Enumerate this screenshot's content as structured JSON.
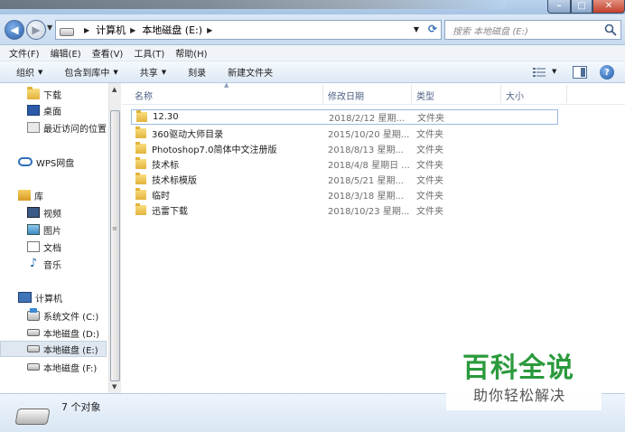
{
  "address": {
    "crumbs": [
      "计算机",
      "本地磁盘 (E:)"
    ]
  },
  "search": {
    "placeholder": "搜索 本地磁盘 (E:)"
  },
  "menu": [
    "文件(F)",
    "编辑(E)",
    "查看(V)",
    "工具(T)",
    "帮助(H)"
  ],
  "commands": {
    "organize": "组织",
    "include": "包含到库中",
    "share": "共享",
    "burn": "刻录",
    "new_folder": "新建文件夹"
  },
  "nav": {
    "downloads": "下载",
    "desktop": "桌面",
    "recent": "最近访问的位置",
    "wps": "WPS网盘",
    "libraries": "库",
    "videos": "视频",
    "pictures": "图片",
    "documents": "文档",
    "music": "音乐",
    "computer": "计算机",
    "drive_c": "系统文件 (C:)",
    "drive_d": "本地磁盘 (D:)",
    "drive_e": "本地磁盘 (E:)",
    "drive_f": "本地磁盘 (F:)"
  },
  "columns": {
    "name": "名称",
    "date": "修改日期",
    "type": "类型",
    "size": "大小"
  },
  "files": [
    {
      "name": "12.30",
      "date": "2018/2/12 星期...",
      "type": "文件夹"
    },
    {
      "name": "360驱动大师目录",
      "date": "2015/10/20 星期...",
      "type": "文件夹"
    },
    {
      "name": "Photoshop7.0简体中文注册版",
      "date": "2018/8/13 星期...",
      "type": "文件夹"
    },
    {
      "name": "技术标",
      "date": "2018/4/8 星期日 ...",
      "type": "文件夹"
    },
    {
      "name": "技术标模版",
      "date": "2018/5/21 星期...",
      "type": "文件夹"
    },
    {
      "name": "临时",
      "date": "2018/3/18 星期...",
      "type": "文件夹"
    },
    {
      "name": "迅雷下载",
      "date": "2018/10/23 星期...",
      "type": "文件夹"
    }
  ],
  "status": {
    "count": "7 个对象"
  },
  "watermark": {
    "title": "百科全说",
    "subtitle": "助你轻松解决"
  }
}
